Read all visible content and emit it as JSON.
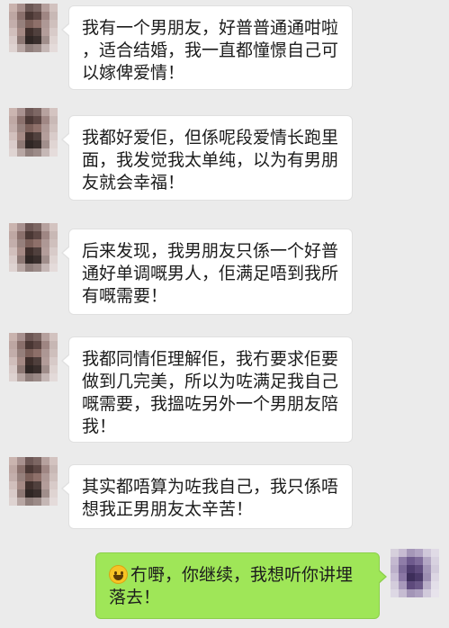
{
  "messages": [
    {
      "side": "left",
      "lines": [
        "我有一个男朋友，好普普通通咁啦",
        "，适合结婚，我一直都憧憬自己可",
        "以嫁俾爱情！"
      ]
    },
    {
      "side": "left",
      "lines": [
        "我都好爱佢，但係呢段爱情长跑里",
        "面，我发觉我太单纯，以为有男朋",
        "友就会幸福！"
      ]
    },
    {
      "side": "left",
      "lines": [
        "后来发现，我男朋友只係一个好普",
        "通好单调嘅男人，佢满足唔到我所",
        "有嘅需要！"
      ]
    },
    {
      "side": "left",
      "lines": [
        "我都同情佢理解佢，我冇要求佢要",
        "做到几完美，所以为咗满足我自己",
        "嘅需要，我搵咗另外一个男朋友陪",
        "我！"
      ]
    },
    {
      "side": "left",
      "lines": [
        "其实都唔算为咗我自己，我只係唔",
        "想我正男朋友太辛苦！"
      ]
    },
    {
      "side": "right",
      "emoji": "smile-emoji-icon",
      "lines": [
        "冇嘢，你继续，我想听你讲埋",
        "落去！"
      ]
    }
  ]
}
